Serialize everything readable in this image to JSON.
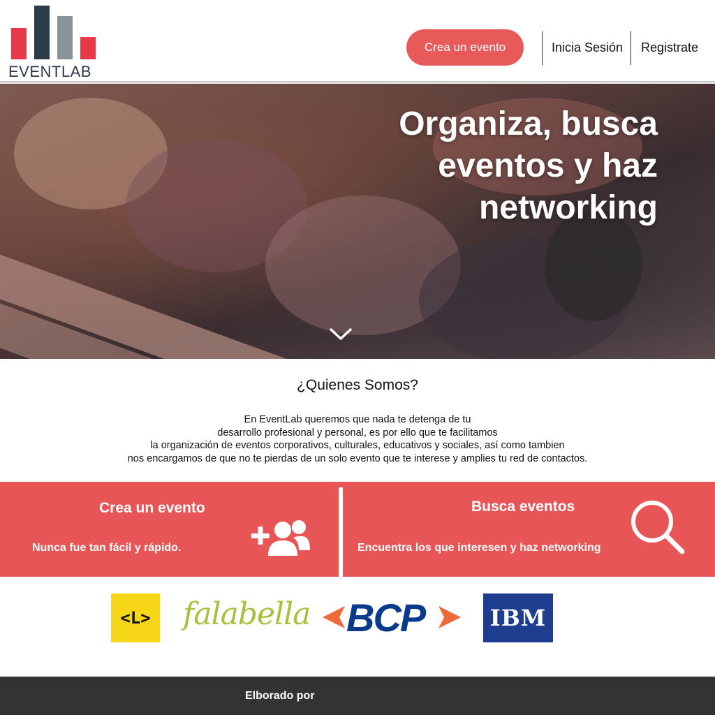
{
  "brand": {
    "name": "EVENTLAB",
    "colors": {
      "red": "#e8595a",
      "navy": "#2c3a49",
      "gray": "#8a929b",
      "logo_red": "#e8394a"
    }
  },
  "nav": {
    "create_event": "Crea un evento",
    "login": "Inicia Sesión",
    "register": "Registrate"
  },
  "hero": {
    "title_lines": [
      "Organiza, busca",
      "eventos y haz",
      "networking"
    ],
    "scroll_icon": "chevron-down-icon"
  },
  "about": {
    "title": "¿Quienes Somos?",
    "lines": [
      "En EventLab queremos que nada te detenga de tu",
      "desarrollo profesional y personal, es por ello que te facilitamos",
      "la organización de eventos corporativos, culturales, educativos y sociales, así como tambien",
      "nos encargamos de que no te pierdas de un solo evento que te interese y amplies tu red de contactos."
    ]
  },
  "features": [
    {
      "title": "Crea un evento",
      "subtitle": "Nunca fue tan fácil y rápido.",
      "icon": "add-users-icon"
    },
    {
      "title": "Busca eventos",
      "subtitle": "Encuentra los que interesen y haz networking",
      "icon": "search-icon"
    }
  ],
  "partners": [
    {
      "name": "<L>",
      "bg": "#f7d617"
    },
    {
      "name": "falabella",
      "color": "#a6c23a"
    },
    {
      "name": "BCP",
      "color": "#0a3a8c",
      "accent": "#ef6a3a"
    },
    {
      "name": "IBM",
      "bg": "#1e3d8f"
    }
  ],
  "footer": {
    "text": "Elborado por"
  }
}
